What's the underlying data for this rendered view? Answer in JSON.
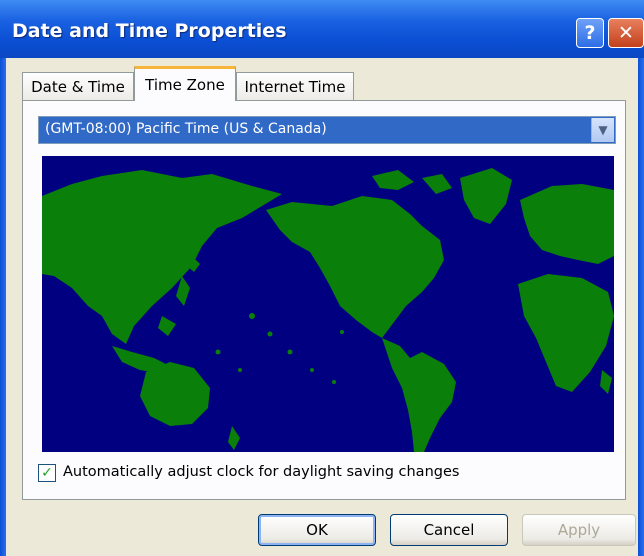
{
  "window": {
    "title": "Date and Time Properties"
  },
  "titlebar": {
    "help_label": "?",
    "close_label": "✕"
  },
  "tabs": [
    {
      "label": "Date & Time",
      "active": false
    },
    {
      "label": "Time Zone",
      "active": true
    },
    {
      "label": "Internet Time",
      "active": false
    }
  ],
  "timezone": {
    "selected": "(GMT-08:00) Pacific Time (US & Canada)"
  },
  "map": {
    "icon": "world-map",
    "ocean_color": "#000080",
    "land_color": "#0a7f0a"
  },
  "daylight": {
    "label": "Automatically adjust clock for daylight saving changes",
    "checked": true,
    "check_mark": "✓"
  },
  "buttons": {
    "ok": "OK",
    "cancel": "Cancel",
    "apply": "Apply"
  },
  "colors": {
    "titlebar": "#0b4fd4",
    "dialog_bg": "#ece9d8",
    "selection": "#3169c6"
  }
}
